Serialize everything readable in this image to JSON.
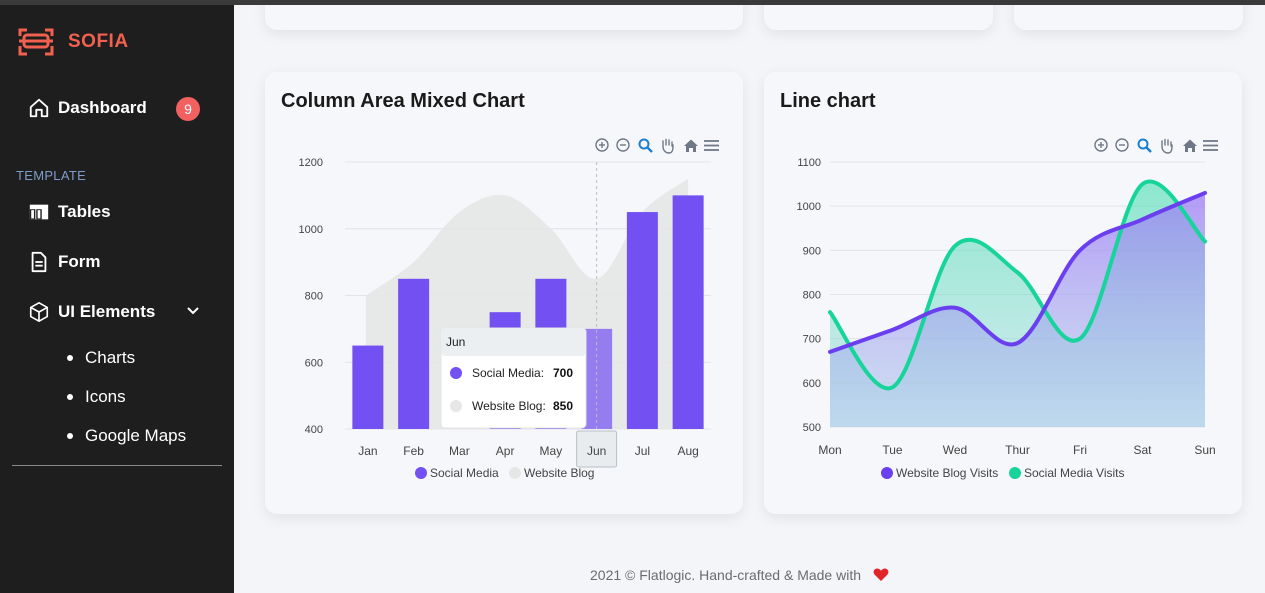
{
  "brand": {
    "name": "SOFIA",
    "accent": "#f2604f"
  },
  "sidebar": {
    "dashboard": {
      "label": "Dashboard",
      "badge": "9"
    },
    "section_label": "TEMPLATE",
    "items": [
      {
        "label": "Tables",
        "icon": "table-icon"
      },
      {
        "label": "Form",
        "icon": "form-icon"
      },
      {
        "label": "UI Elements",
        "icon": "cube-icon"
      }
    ],
    "sub_items": [
      "Charts",
      "Icons",
      "Google Maps"
    ]
  },
  "charts": {
    "mixed": {
      "title": "Column Area Mixed Chart"
    },
    "line": {
      "title": "Line chart"
    }
  },
  "chart_data": [
    {
      "type": "bar",
      "title": "Column Area Mixed Chart",
      "categories": [
        "Jan",
        "Feb",
        "Mar",
        "Apr",
        "May",
        "Jun",
        "Jul",
        "Aug"
      ],
      "ylim": [
        400,
        1200
      ],
      "yticks": [
        400,
        600,
        800,
        1000,
        1200
      ],
      "series": [
        {
          "name": "Social Media",
          "type": "column",
          "color": "#7350f2",
          "values": [
            650,
            850,
            400,
            750,
            850,
            700,
            1050,
            1100
          ]
        },
        {
          "name": "Website Blog",
          "type": "area",
          "color": "#e6e6e6",
          "values": [
            800,
            900,
            1050,
            1100,
            1000,
            850,
            1050,
            1150
          ]
        }
      ],
      "tooltip": {
        "category": "Jun",
        "rows": [
          {
            "label": "Social Media:",
            "value": "700"
          },
          {
            "label": "Website Blog:",
            "value": "850"
          }
        ]
      },
      "legend": "bottom-center",
      "grid": true
    },
    {
      "type": "area",
      "title": "Line chart",
      "categories": [
        "Mon",
        "Tue",
        "Wed",
        "Thur",
        "Fri",
        "Sat",
        "Sun"
      ],
      "ylim": [
        500,
        1100
      ],
      "yticks": [
        500,
        600,
        700,
        800,
        900,
        1000,
        1100
      ],
      "series": [
        {
          "name": "Website Blog Visits",
          "color": "#6a3ff0",
          "values": [
            670,
            720,
            770,
            690,
            900,
            970,
            1030
          ]
        },
        {
          "name": "Social Media Visits",
          "color": "#17d49a",
          "values": [
            760,
            590,
            910,
            850,
            700,
            1050,
            920
          ]
        }
      ],
      "legend": "bottom-center",
      "grid": true
    }
  ],
  "toolbar_icons": [
    "zoom-in-icon",
    "zoom-out-icon",
    "selection-zoom-icon",
    "pan-hand-icon",
    "home-reset-icon",
    "menu-icon"
  ],
  "footer": {
    "text": "2021 © Flatlogic. Hand-crafted & Made with",
    "heart_color": "#e0242a"
  }
}
